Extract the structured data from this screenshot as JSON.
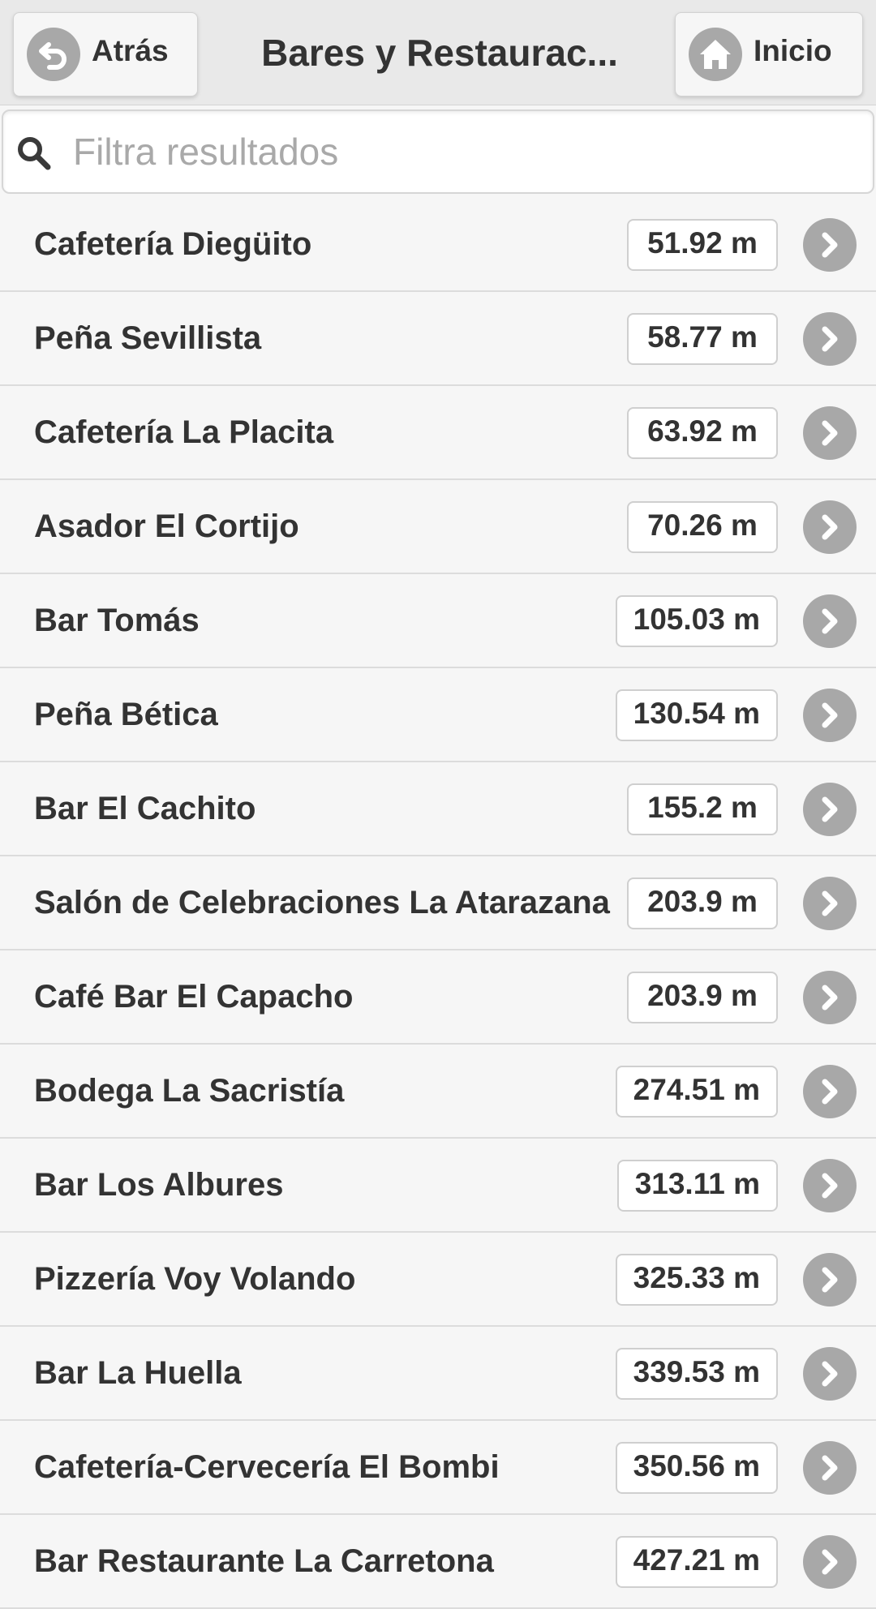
{
  "header": {
    "back_label": "Atrás",
    "title": "Bares y Restaurac...",
    "home_label": "Inicio"
  },
  "search": {
    "placeholder": "Filtra resultados",
    "value": ""
  },
  "items": [
    {
      "name": "Cafetería Diegüito",
      "distance": "51.92 m"
    },
    {
      "name": "Peña Sevillista",
      "distance": "58.77 m"
    },
    {
      "name": "Cafetería La Placita",
      "distance": "63.92 m"
    },
    {
      "name": "Asador El Cortijo",
      "distance": "70.26 m"
    },
    {
      "name": "Bar Tomás",
      "distance": "105.03 m"
    },
    {
      "name": "Peña Bética",
      "distance": "130.54 m"
    },
    {
      "name": "Bar El Cachito",
      "distance": "155.2 m"
    },
    {
      "name": "Salón de Celebraciones La Atarazana",
      "distance": "203.9 m"
    },
    {
      "name": "Café Bar El Capacho",
      "distance": "203.9 m"
    },
    {
      "name": "Bodega La Sacristía",
      "distance": "274.51 m"
    },
    {
      "name": "Bar Los Albures",
      "distance": "313.11 m"
    },
    {
      "name": "Pizzería Voy Volando",
      "distance": "325.33 m"
    },
    {
      "name": "Bar La Huella",
      "distance": "339.53 m"
    },
    {
      "name": "Cafetería-Cervecería El Bombi",
      "distance": "350.56 m"
    },
    {
      "name": "Bar Restaurante La Carretona",
      "distance": "427.21 m"
    }
  ],
  "icons": {
    "back": "back-arrow-icon",
    "home": "home-icon",
    "search": "search-icon",
    "chevron": "chevron-right-icon"
  },
  "colors": {
    "header_bg": "#e9e9e9",
    "list_bg": "#f6f6f6",
    "icon_gray": "#a8a8a8",
    "text": "#333333"
  }
}
